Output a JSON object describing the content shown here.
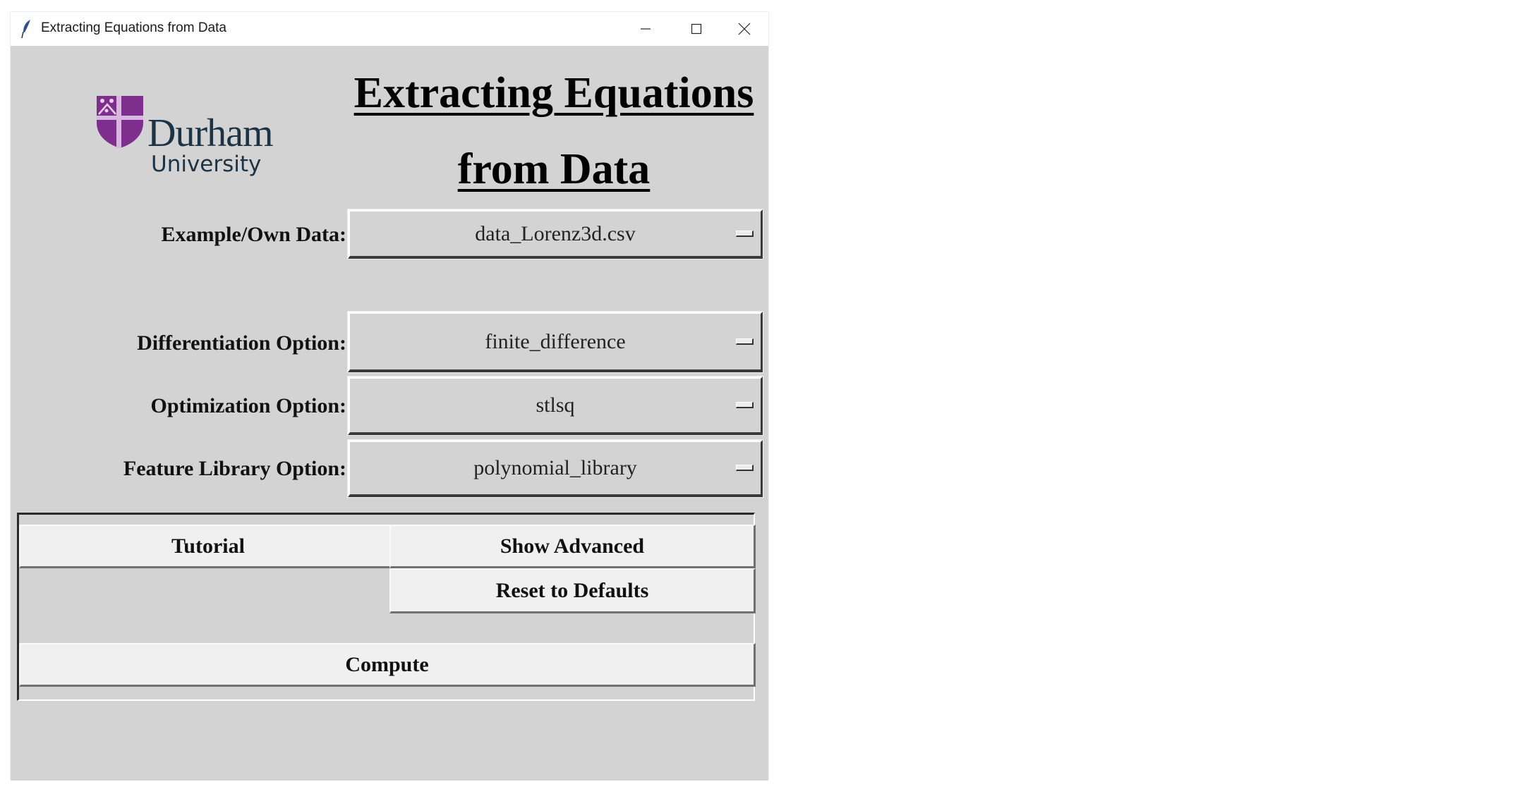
{
  "window": {
    "title": "Extracting Equations from Data",
    "controls": {
      "minimize": "minimize",
      "maximize": "maximize",
      "close": "close"
    }
  },
  "logo": {
    "name": "Durham",
    "subtitle": "University",
    "shield_color": "#7e2f8e",
    "text_color": "#1c3345"
  },
  "heading": {
    "line1": "Extracting Equations",
    "line2": "from Data"
  },
  "options": [
    {
      "label": "Example/Own Data:",
      "value": "data_Lorenz3d.csv"
    },
    {
      "label": "Differentiation Option:",
      "value": "finite_difference"
    },
    {
      "label": "Optimization Option:",
      "value": "stlsq"
    },
    {
      "label": "Feature Library Option:",
      "value": "polynomial_library"
    }
  ],
  "buttons": {
    "tutorial": "Tutorial",
    "show_advanced": "Show Advanced",
    "reset": "Reset to Defaults",
    "compute": "Compute"
  },
  "colors": {
    "window_bg": "#d3d3d3",
    "button_bg": "#f0f0f0"
  }
}
